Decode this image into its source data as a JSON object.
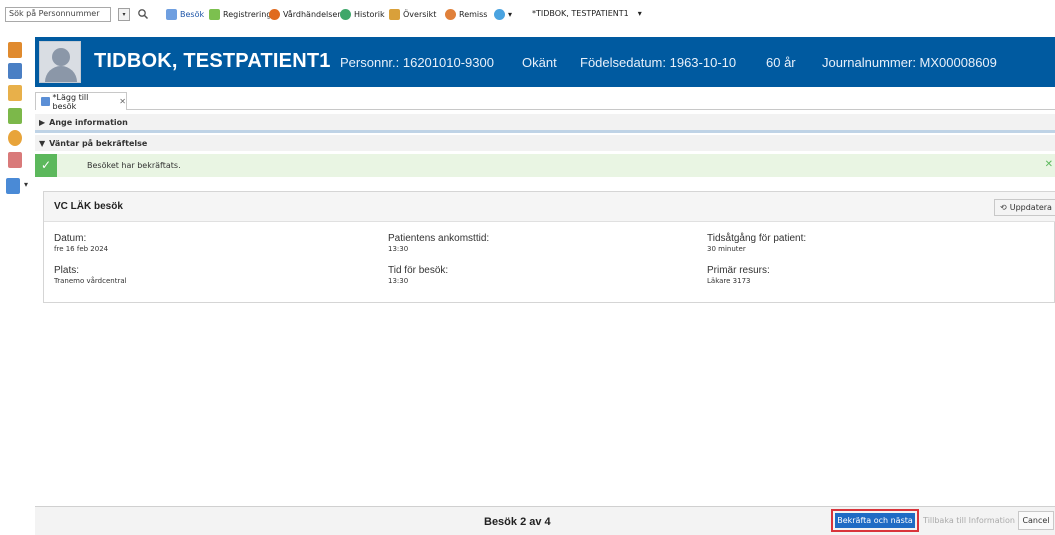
{
  "toolbar": {
    "search_placeholder": "Sök på Personnummer",
    "items": [
      {
        "label": "Besök",
        "icon": "visit-icon"
      },
      {
        "label": "Registrering",
        "icon": "pencil-icon"
      },
      {
        "label": "Vårdhändelser",
        "icon": "care-event-icon"
      },
      {
        "label": "Historik",
        "icon": "history-icon"
      },
      {
        "label": "Översikt",
        "icon": "overview-icon"
      },
      {
        "label": "Remiss",
        "icon": "referral-icon"
      }
    ],
    "patient_tab": "*TIDBOK, TESTPATIENT1"
  },
  "patient": {
    "name": "TIDBOK, TESTPATIENT1",
    "personnr": "Personnr.: 16201010-9300",
    "gender": "Okänt",
    "birthdate": "Födelsedatum: 1963-10-10",
    "age": "60 år",
    "journal": "Journalnummer: MX00008609"
  },
  "tab": {
    "label": "*Lägg till besök",
    "close": "✕"
  },
  "sections": {
    "info": "Ange information",
    "waiting": "Väntar på bekräftelse"
  },
  "success": {
    "message": "Besöket har bekräftats."
  },
  "visit": {
    "title": "VC LÄK besök",
    "update_label": "Uppdatera",
    "fields": {
      "datum_label": "Datum:",
      "datum_value": "fre 16 feb 2024",
      "arrival_label": "Patientens ankomsttid:",
      "arrival_value": "13:30",
      "time_label": "Tidsåtgång för patient:",
      "time_value": "30 minuter",
      "place_label": "Plats:",
      "place_value": "Tranemo vårdcentral",
      "visit_time_label": "Tid för besök:",
      "visit_time_value": "13:30",
      "resource_label": "Primär resurs:",
      "resource_value": "Läkare 3173"
    }
  },
  "footer": {
    "counter": "Besök 2 av 4",
    "confirm_next": "Bekräfta och nästa",
    "back": "Tillbaka till Information",
    "cancel": "Cancel"
  },
  "colors": {
    "header_blue": "#005aa0",
    "success_green": "#5cb85c",
    "primary_button": "#1f6bc4",
    "highlight_red": "#d9343b"
  }
}
